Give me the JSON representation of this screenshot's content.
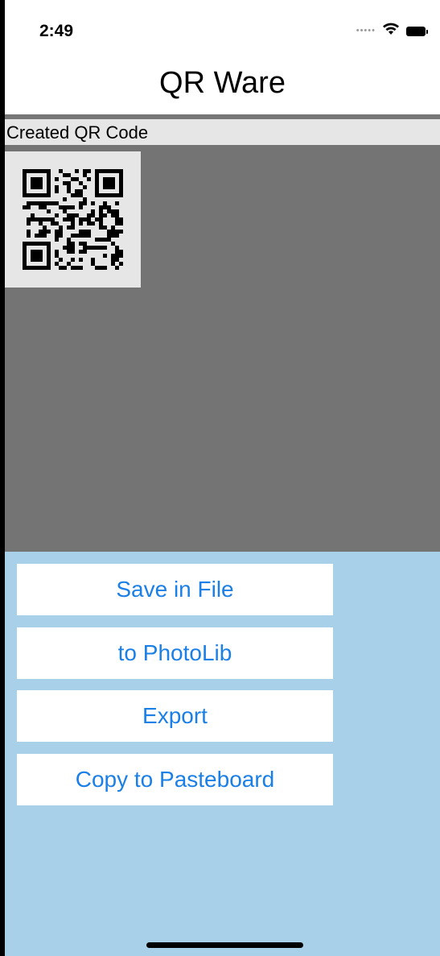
{
  "status_bar": {
    "time": "2:49",
    "signal_icon": "cellular-dots-icon",
    "wifi_icon": "wifi-icon",
    "battery_icon": "battery-icon"
  },
  "nav": {
    "title": "QR Ware"
  },
  "preview": {
    "header": "Created QR Code",
    "qr_icon": "qr-code-icon"
  },
  "actions": [
    {
      "label": "Save in File"
    },
    {
      "label": "to PhotoLib"
    },
    {
      "label": "Export"
    },
    {
      "label": "Copy to Pasteboard"
    }
  ],
  "colors": {
    "action_text": "#1a7fe6",
    "actions_background": "#a8d1e9",
    "preview_background": "#747474",
    "header_background": "#e6e6e6"
  }
}
